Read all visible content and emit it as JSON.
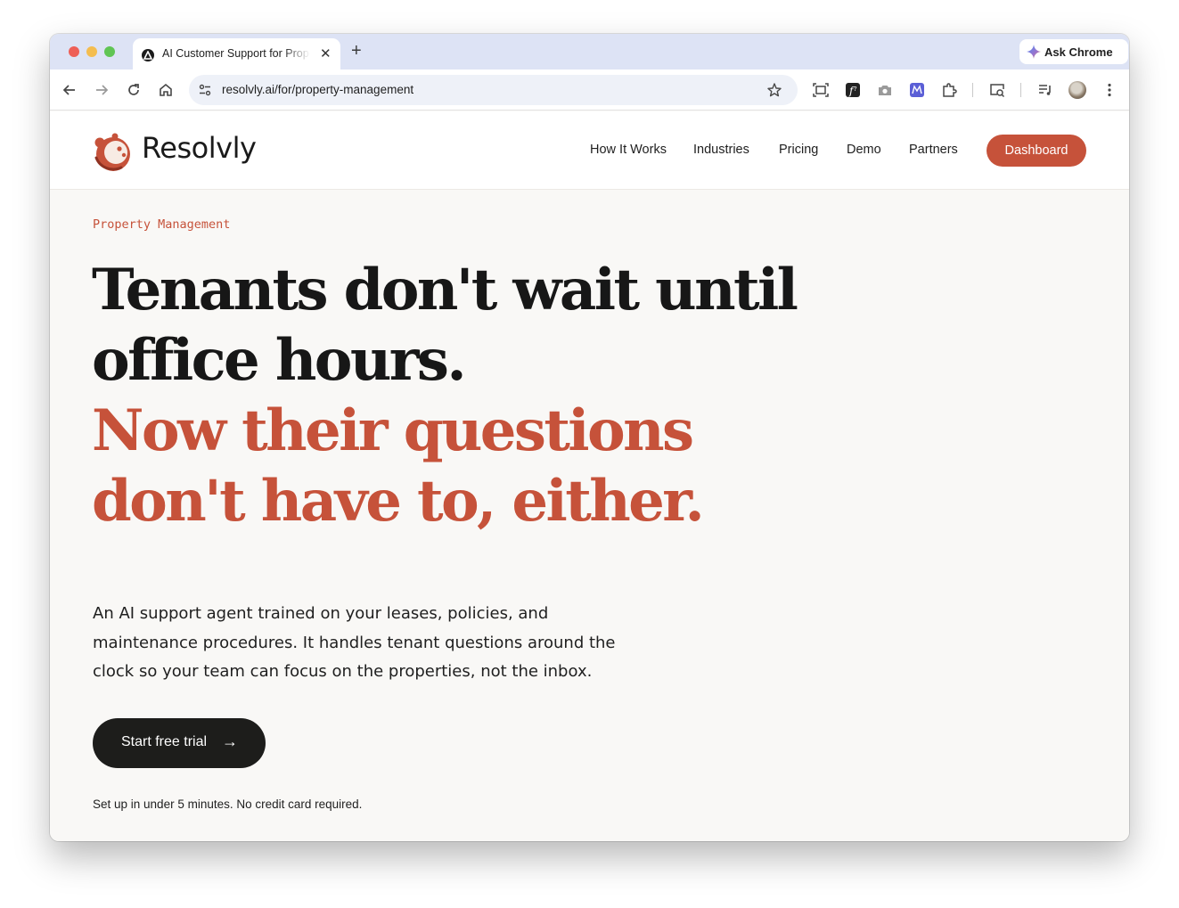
{
  "browser": {
    "tab_title": "AI Customer Support for Property Management",
    "new_tab": "+",
    "close_tab": "✕",
    "ask_chrome": "Ask Chrome",
    "url": "resolvly.ai/for/property-management"
  },
  "site": {
    "logo_text": "Resolvly",
    "nav": [
      "How It Works",
      "Industries",
      "Pricing",
      "Demo",
      "Partners"
    ],
    "dashboard_label": "Dashboard"
  },
  "hero": {
    "eyebrow": "Property Management",
    "headline_line1": "Tenants don't wait until",
    "headline_line2": "office hours.",
    "headline_accent_line1": "Now their questions",
    "headline_accent_line2": "don't have to, either.",
    "lead": "An AI support agent trained on your leases, policies, and maintenance procedures. It handles tenant questions around the clock so your team can focus on the properties, not the inbox.",
    "cta_label": "Start free trial",
    "cta_arrow": "→",
    "fineprint": "Set up in under 5 minutes. No credit card required."
  },
  "colors": {
    "accent": "#c6523a",
    "text": "#171717",
    "page_bg": "#f9f8f6",
    "tab_strip": "#dde3f5"
  }
}
